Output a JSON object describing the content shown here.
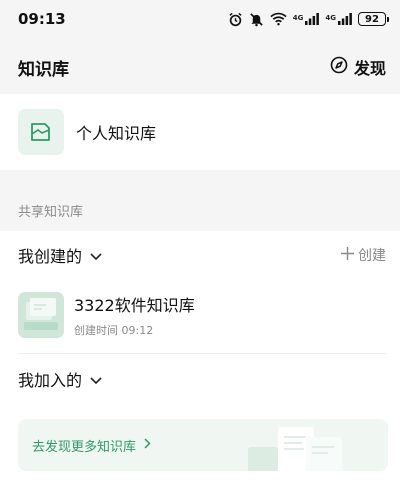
{
  "status_bar": {
    "time": "09:13",
    "network_tag_1": "4G",
    "network_tag_2": "4G",
    "battery": "92"
  },
  "header": {
    "title": "知识库",
    "discover_label": "发现"
  },
  "personal": {
    "label": "个人知识库"
  },
  "shared": {
    "section_label": "共享知识库",
    "created_heading": "我创建的",
    "create_label": "创建",
    "items": [
      {
        "title": "3322软件知识库",
        "meta": "创建时间 09:12"
      }
    ],
    "joined_heading": "我加入的"
  },
  "banner": {
    "text": "去发现更多知识库"
  },
  "colors": {
    "accent_green": "#2f9a66",
    "icon_bg": "#e8f3ee",
    "banner_bg": "#f0f7f3"
  },
  "icons": {
    "alarm": "alarm-icon",
    "mute": "bell-off-icon",
    "wifi": "wifi-icon",
    "discover": "compass-icon",
    "personal": "folder-icon",
    "chevron": "chevron-down-icon",
    "add": "plus-icon",
    "arrow": "chevron-right-icon"
  }
}
